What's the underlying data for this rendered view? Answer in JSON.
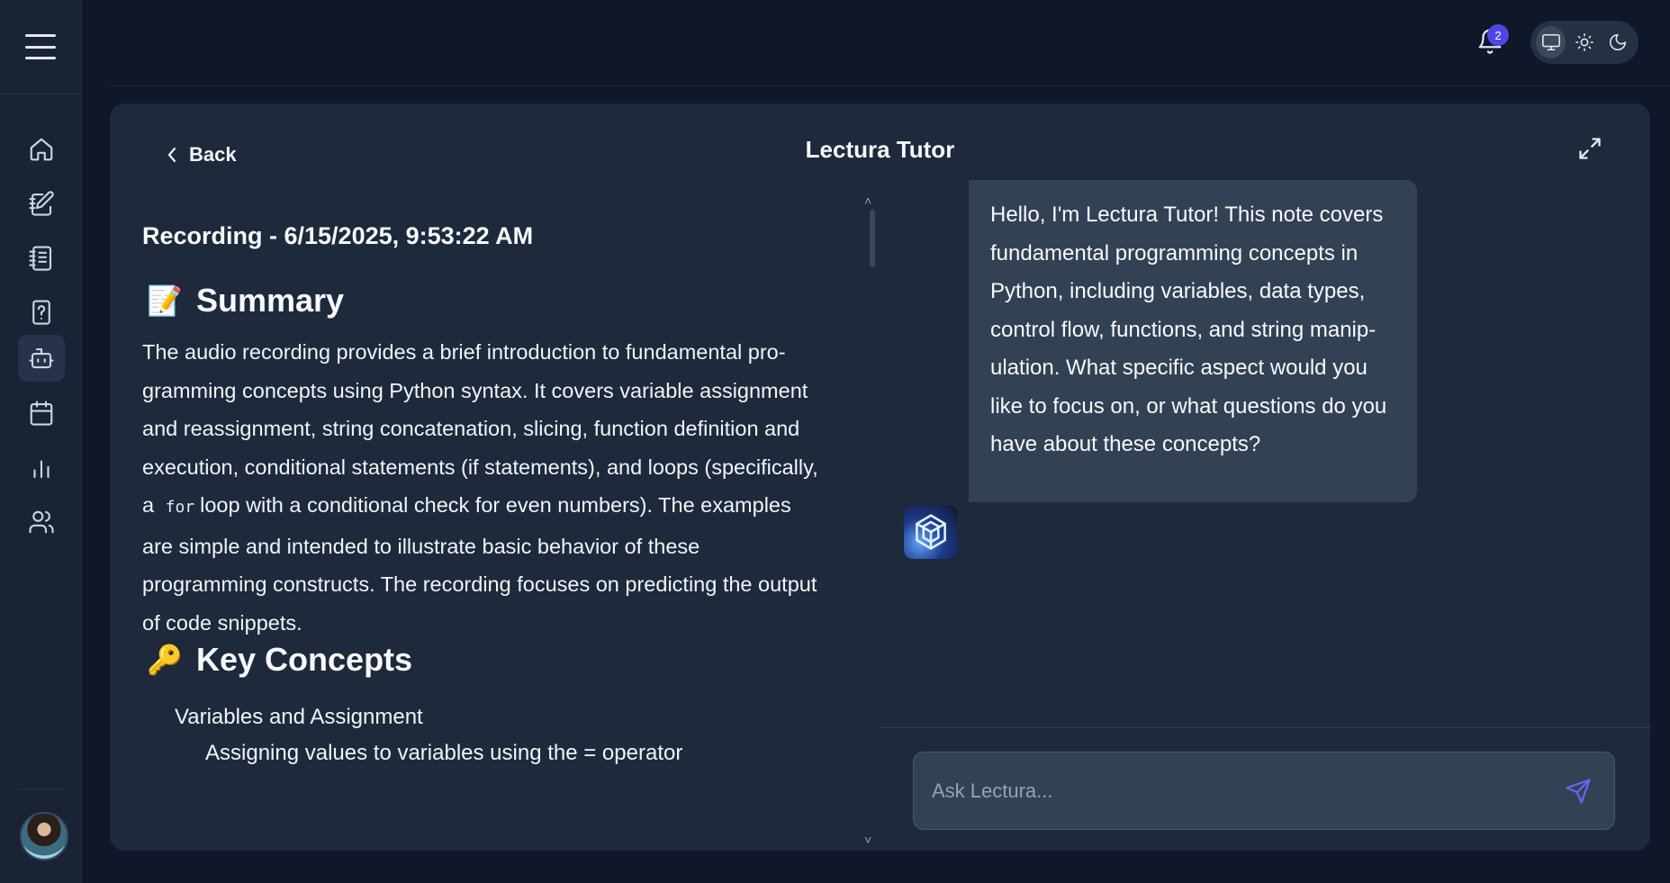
{
  "header": {
    "notification_count": "2",
    "theme_options": [
      "system",
      "light",
      "dark"
    ]
  },
  "sidebar": {
    "items": [
      {
        "icon": "home-icon"
      },
      {
        "icon": "notebook-pen-icon"
      },
      {
        "icon": "notes-icon"
      },
      {
        "icon": "quiz-icon"
      },
      {
        "icon": "bot-icon",
        "active": true
      },
      {
        "icon": "calendar-icon"
      },
      {
        "icon": "bar-chart-icon"
      },
      {
        "icon": "users-icon"
      }
    ]
  },
  "panel": {
    "back_label": "Back",
    "title": "Lectura Tutor"
  },
  "note": {
    "title": "Recording - 6/15/2025, 9:53:22 AM",
    "summary_heading": "Summary",
    "summary_emoji": "📝",
    "summary_before_code": "The audio recording provides a brief introduction to fundamental pro­gramming concepts using Python syntax. It covers variable assignment and reassignment, string concatenation, slicing, function definition and execution, conditional statements (if statements), and loops (specifi­cally, a",
    "summary_code": "for",
    "summary_after_code": "loop with a conditional check for even numbers). The ex­amples are simple and intended to illustrate basic behavior of these programming constructs. The recording focuses on predicting the out­put of code snippets.",
    "key_concepts_heading": "Key Concepts",
    "key_concepts_emoji": "🔑",
    "concept_1": "Variables and Assignment",
    "concept_1_sub": "Assigning values to variables using the = operator"
  },
  "chat": {
    "bot_message": "Hello, I'm Lectura Tutor! This note covers fundamental programming concepts in Python, including variables, data types, control flow, functions, and string manip­ulation. What specific aspect would you like to focus on, or what questions do you have about these concepts?",
    "input_placeholder": "Ask Lectura..."
  },
  "colors": {
    "background": "#0f1729",
    "panel": "#1e293b",
    "bubble": "#334155",
    "accent": "#4f46e5",
    "send": "#6366f1"
  }
}
